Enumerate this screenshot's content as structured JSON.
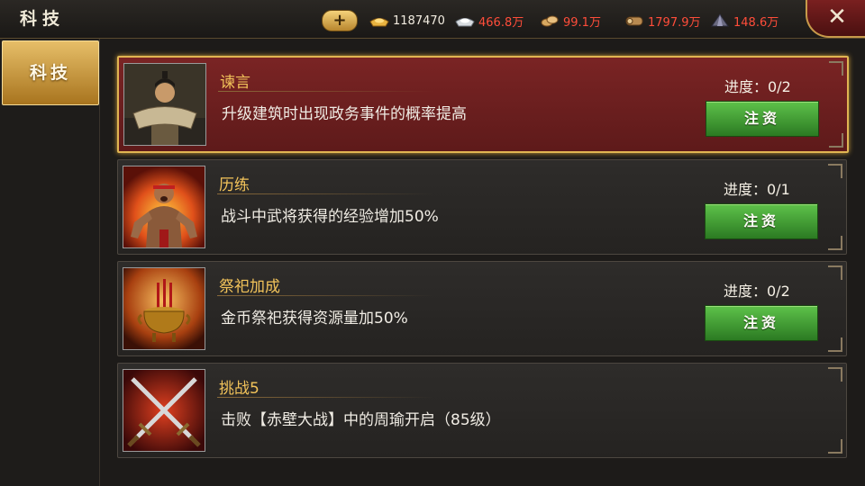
{
  "header": {
    "title": "科技",
    "add_label": "+",
    "close_label": "✕",
    "resources": [
      {
        "name": "gold-ingot-icon",
        "value": "1187470",
        "color": "#f2ece0"
      },
      {
        "name": "silver-ingot-icon",
        "value": "466.8万",
        "color": "#ff4d3a"
      },
      {
        "name": "grain-icon",
        "value": "99.1万",
        "color": "#ff4d3a"
      },
      {
        "name": "wood-icon",
        "value": "1797.9万",
        "color": "#ff4d3a"
      },
      {
        "name": "iron-icon",
        "value": "148.6万",
        "color": "#ff4d3a"
      }
    ]
  },
  "sidebar": {
    "tab_label": "科技"
  },
  "techs": [
    {
      "title": "谏言",
      "desc": "升级建筑时出现政务事件的概率提高",
      "progress": "进度：0/2",
      "button": "注资",
      "selected": true,
      "icon": "advisor-portrait-icon"
    },
    {
      "title": "历练",
      "desc": "战斗中武将获得的经验增加50%",
      "progress": "进度：0/1",
      "button": "注资",
      "selected": false,
      "icon": "warrior-portrait-icon"
    },
    {
      "title": "祭祀加成",
      "desc": "金币祭祀获得资源量加50%",
      "progress": "进度：0/2",
      "button": "注资",
      "selected": false,
      "icon": "incense-burner-icon"
    },
    {
      "title": "挑战5",
      "desc": "击败【赤壁大战】中的周瑜开启（85级）",
      "progress": "",
      "button": "",
      "selected": false,
      "icon": "crossed-swords-icon"
    }
  ],
  "colors": {
    "accent": "#e0b552",
    "button_green": "#3c9a30",
    "selected_bg": "#6e2020",
    "title_gold": "#f2c35a"
  }
}
